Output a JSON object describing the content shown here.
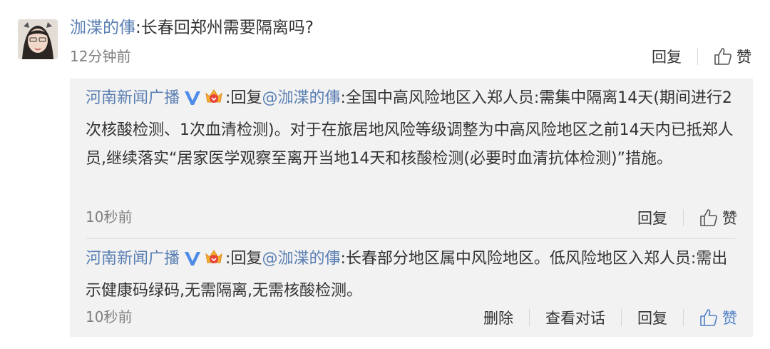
{
  "comment": {
    "author": "泇渫的倳",
    "separator": ":",
    "text": "长春回郑州需要隔离吗?",
    "time": "12分钟前",
    "reply_label": "回复",
    "like_label": "赞"
  },
  "replies": [
    {
      "author": "河南新闻广播",
      "colon": ":",
      "reply_prefix": "回复",
      "mention": "@泇渫的倳",
      "text": ":全国中高风险地区入郑人员:需集中隔离14天(期间进行2次核酸检测、1次血清检测)。对于在旅居地风险等级调整为中高风险地区之前14天内已抵郑人员,继续落实“居家医学观察至离开当地14天和核酸检测(必要时血清抗体检测)”措施。",
      "time": "10秒前",
      "reply_label": "回复",
      "like_label": "赞"
    },
    {
      "author": "河南新闻广播",
      "colon": ":",
      "reply_prefix": "回复",
      "mention": "@泇渫的倳",
      "text": ":长春部分地区属中风险地区。低风险地区入郑人员:需出示健康码绿码,无需隔离,无需核酸检测。",
      "time": "10秒前",
      "delete_label": "删除",
      "view_conversation_label": "查看对话",
      "reply_label": "回复",
      "like_label": "赞"
    }
  ],
  "icons": {
    "verified": "verified-v-icon",
    "crown": "crown-badge-icon",
    "like": "thumbs-up-icon"
  },
  "colors": {
    "link": "#5a7fb3",
    "verified": "#4f8ce8",
    "like_active": "#4f80c8",
    "reply_bg": "#f2f2f2"
  }
}
